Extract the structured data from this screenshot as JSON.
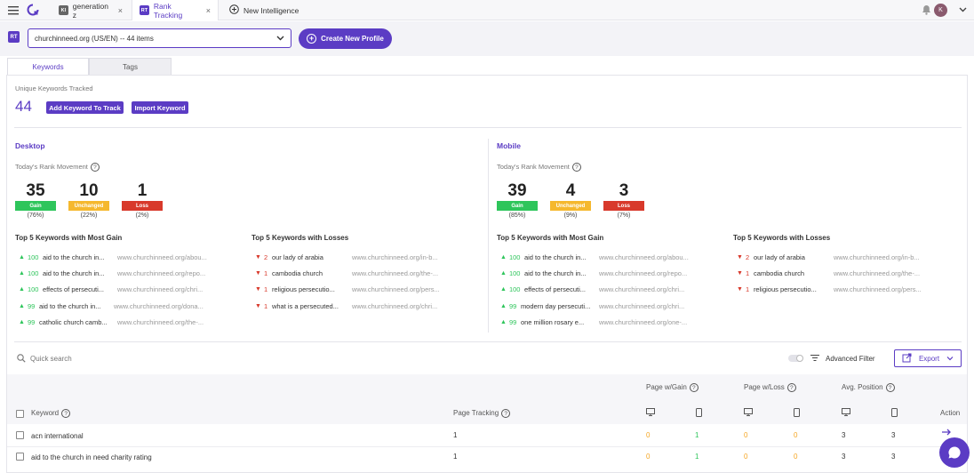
{
  "browser": {
    "tabs": [
      {
        "badge": "KI",
        "label": "generation z"
      },
      {
        "badge": "RT",
        "label": "Rank Tracking"
      }
    ],
    "new_tab_label": "New Intelligence",
    "close_glyph": "×",
    "avatar_initial": "K"
  },
  "header": {
    "badge": "RT",
    "profile_select": "churchinneed.org (US/EN) -- 44 items",
    "create_button": "Create New Profile"
  },
  "panel_tabs": [
    "Keywords",
    "Tags"
  ],
  "summary": {
    "unique_label": "Unique Keywords Tracked",
    "unique_count": "44",
    "add_keyword_button": "Add Keyword To Track",
    "import_keyword_button": "Import Keyword"
  },
  "desktop": {
    "title": "Desktop",
    "movement_label": "Today's Rank Movement",
    "gain": {
      "value": "35",
      "label": "Gain",
      "pct": "(76%)"
    },
    "unchanged": {
      "value": "10",
      "label": "Unchanged",
      "pct": "(22%)"
    },
    "loss": {
      "value": "1",
      "label": "Loss",
      "pct": "(2%)"
    },
    "most_gain_title": "Top 5 Keywords with Most Gain",
    "losses_title": "Top 5 Keywords with Losses",
    "most_gain": [
      {
        "change": "100",
        "keyword": "aid to the church in...",
        "url": "www.churchinneed.org/abou..."
      },
      {
        "change": "100",
        "keyword": "aid to the church in...",
        "url": "www.churchinneed.org/repo..."
      },
      {
        "change": "100",
        "keyword": "effects of persecuti...",
        "url": "www.churchinneed.org/chri..."
      },
      {
        "change": "99",
        "keyword": "aid to the church in...",
        "url": "www.churchinneed.org/dona..."
      },
      {
        "change": "99",
        "keyword": "catholic church camb...",
        "url": "www.churchinneed.org/the-..."
      }
    ],
    "losses": [
      {
        "change": "2",
        "keyword": "our lady of arabia",
        "url": "www.churchinneed.org/in-b..."
      },
      {
        "change": "1",
        "keyword": "cambodia church",
        "url": "www.churchinneed.org/the-..."
      },
      {
        "change": "1",
        "keyword": "religious persecutio...",
        "url": "www.churchinneed.org/pers..."
      },
      {
        "change": "1",
        "keyword": "what is a persecuted...",
        "url": "www.churchinneed.org/chri..."
      }
    ]
  },
  "mobile": {
    "title": "Mobile",
    "movement_label": "Today's Rank Movement",
    "gain": {
      "value": "39",
      "label": "Gain",
      "pct": "(85%)"
    },
    "unchanged": {
      "value": "4",
      "label": "Unchanged",
      "pct": "(9%)"
    },
    "loss": {
      "value": "3",
      "label": "Loss",
      "pct": "(7%)"
    },
    "most_gain_title": "Top 5 Keywords with Most Gain",
    "losses_title": "Top 5 Keywords with Losses",
    "most_gain": [
      {
        "change": "100",
        "keyword": "aid to the church in...",
        "url": "www.churchinneed.org/abou..."
      },
      {
        "change": "100",
        "keyword": "aid to the church in...",
        "url": "www.churchinneed.org/repo..."
      },
      {
        "change": "100",
        "keyword": "effects of persecuti...",
        "url": "www.churchinneed.org/chri..."
      },
      {
        "change": "99",
        "keyword": "modern day persecuti...",
        "url": "www.churchinneed.org/chri..."
      },
      {
        "change": "99",
        "keyword": "one million rosary e...",
        "url": "www.churchinneed.org/one-..."
      }
    ],
    "losses": [
      {
        "change": "2",
        "keyword": "our lady of arabia",
        "url": "www.churchinneed.org/in-b..."
      },
      {
        "change": "1",
        "keyword": "cambodia church",
        "url": "www.churchinneed.org/the-..."
      },
      {
        "change": "1",
        "keyword": "religious persecutio...",
        "url": "www.churchinneed.org/pers..."
      }
    ]
  },
  "toolbar": {
    "search_placeholder": "Quick search",
    "advanced_filter": "Advanced Filter",
    "export": "Export"
  },
  "table": {
    "group_headers": [
      "Page w/Gain",
      "Page w/Loss",
      "Avg. Position"
    ],
    "col_keyword": "Keyword",
    "col_page_tracking": "Page Tracking",
    "col_action": "Action",
    "rows": [
      {
        "keyword": "acn international",
        "page_tracking": "1",
        "gain_desktop": "0",
        "gain_mobile": "1",
        "loss_desktop": "0",
        "loss_mobile": "0",
        "avg_desktop": "3",
        "avg_mobile": "3"
      },
      {
        "keyword": "aid to the church in need charity rating",
        "page_tracking": "1",
        "gain_desktop": "0",
        "gain_mobile": "1",
        "loss_desktop": "0",
        "loss_mobile": "0",
        "avg_desktop": "3",
        "avg_mobile": "3"
      }
    ]
  },
  "colors": {
    "accent": "#5b3cc4",
    "gain": "#2ec55b",
    "unchanged": "#f5b82e",
    "loss": "#d8392b"
  }
}
